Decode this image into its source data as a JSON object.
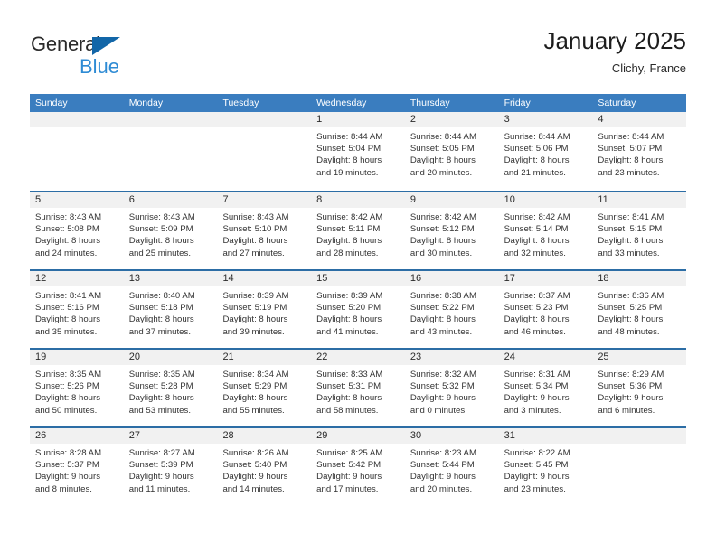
{
  "brand": {
    "name_top": "General",
    "name_bottom": "Blue",
    "triangle_color": "#1266a8",
    "blue_text_color": "#2e8bd4"
  },
  "header": {
    "title": "January 2025",
    "subtitle": "Clichy, France"
  },
  "theme": {
    "header_bar": "#3a7dbf",
    "row_divider": "#2c6da5",
    "day_number_band": "#f1f1f1",
    "cell_background": "#ffffff"
  },
  "weekdays": [
    "Sunday",
    "Monday",
    "Tuesday",
    "Wednesday",
    "Thursday",
    "Friday",
    "Saturday"
  ],
  "weeks": [
    [
      {
        "day": "",
        "lines": []
      },
      {
        "day": "",
        "lines": []
      },
      {
        "day": "",
        "lines": []
      },
      {
        "day": "1",
        "lines": [
          "Sunrise: 8:44 AM",
          "Sunset: 5:04 PM",
          "Daylight: 8 hours",
          "and 19 minutes."
        ]
      },
      {
        "day": "2",
        "lines": [
          "Sunrise: 8:44 AM",
          "Sunset: 5:05 PM",
          "Daylight: 8 hours",
          "and 20 minutes."
        ]
      },
      {
        "day": "3",
        "lines": [
          "Sunrise: 8:44 AM",
          "Sunset: 5:06 PM",
          "Daylight: 8 hours",
          "and 21 minutes."
        ]
      },
      {
        "day": "4",
        "lines": [
          "Sunrise: 8:44 AM",
          "Sunset: 5:07 PM",
          "Daylight: 8 hours",
          "and 23 minutes."
        ]
      }
    ],
    [
      {
        "day": "5",
        "lines": [
          "Sunrise: 8:43 AM",
          "Sunset: 5:08 PM",
          "Daylight: 8 hours",
          "and 24 minutes."
        ]
      },
      {
        "day": "6",
        "lines": [
          "Sunrise: 8:43 AM",
          "Sunset: 5:09 PM",
          "Daylight: 8 hours",
          "and 25 minutes."
        ]
      },
      {
        "day": "7",
        "lines": [
          "Sunrise: 8:43 AM",
          "Sunset: 5:10 PM",
          "Daylight: 8 hours",
          "and 27 minutes."
        ]
      },
      {
        "day": "8",
        "lines": [
          "Sunrise: 8:42 AM",
          "Sunset: 5:11 PM",
          "Daylight: 8 hours",
          "and 28 minutes."
        ]
      },
      {
        "day": "9",
        "lines": [
          "Sunrise: 8:42 AM",
          "Sunset: 5:12 PM",
          "Daylight: 8 hours",
          "and 30 minutes."
        ]
      },
      {
        "day": "10",
        "lines": [
          "Sunrise: 8:42 AM",
          "Sunset: 5:14 PM",
          "Daylight: 8 hours",
          "and 32 minutes."
        ]
      },
      {
        "day": "11",
        "lines": [
          "Sunrise: 8:41 AM",
          "Sunset: 5:15 PM",
          "Daylight: 8 hours",
          "and 33 minutes."
        ]
      }
    ],
    [
      {
        "day": "12",
        "lines": [
          "Sunrise: 8:41 AM",
          "Sunset: 5:16 PM",
          "Daylight: 8 hours",
          "and 35 minutes."
        ]
      },
      {
        "day": "13",
        "lines": [
          "Sunrise: 8:40 AM",
          "Sunset: 5:18 PM",
          "Daylight: 8 hours",
          "and 37 minutes."
        ]
      },
      {
        "day": "14",
        "lines": [
          "Sunrise: 8:39 AM",
          "Sunset: 5:19 PM",
          "Daylight: 8 hours",
          "and 39 minutes."
        ]
      },
      {
        "day": "15",
        "lines": [
          "Sunrise: 8:39 AM",
          "Sunset: 5:20 PM",
          "Daylight: 8 hours",
          "and 41 minutes."
        ]
      },
      {
        "day": "16",
        "lines": [
          "Sunrise: 8:38 AM",
          "Sunset: 5:22 PM",
          "Daylight: 8 hours",
          "and 43 minutes."
        ]
      },
      {
        "day": "17",
        "lines": [
          "Sunrise: 8:37 AM",
          "Sunset: 5:23 PM",
          "Daylight: 8 hours",
          "and 46 minutes."
        ]
      },
      {
        "day": "18",
        "lines": [
          "Sunrise: 8:36 AM",
          "Sunset: 5:25 PM",
          "Daylight: 8 hours",
          "and 48 minutes."
        ]
      }
    ],
    [
      {
        "day": "19",
        "lines": [
          "Sunrise: 8:35 AM",
          "Sunset: 5:26 PM",
          "Daylight: 8 hours",
          "and 50 minutes."
        ]
      },
      {
        "day": "20",
        "lines": [
          "Sunrise: 8:35 AM",
          "Sunset: 5:28 PM",
          "Daylight: 8 hours",
          "and 53 minutes."
        ]
      },
      {
        "day": "21",
        "lines": [
          "Sunrise: 8:34 AM",
          "Sunset: 5:29 PM",
          "Daylight: 8 hours",
          "and 55 minutes."
        ]
      },
      {
        "day": "22",
        "lines": [
          "Sunrise: 8:33 AM",
          "Sunset: 5:31 PM",
          "Daylight: 8 hours",
          "and 58 minutes."
        ]
      },
      {
        "day": "23",
        "lines": [
          "Sunrise: 8:32 AM",
          "Sunset: 5:32 PM",
          "Daylight: 9 hours",
          "and 0 minutes."
        ]
      },
      {
        "day": "24",
        "lines": [
          "Sunrise: 8:31 AM",
          "Sunset: 5:34 PM",
          "Daylight: 9 hours",
          "and 3 minutes."
        ]
      },
      {
        "day": "25",
        "lines": [
          "Sunrise: 8:29 AM",
          "Sunset: 5:36 PM",
          "Daylight: 9 hours",
          "and 6 minutes."
        ]
      }
    ],
    [
      {
        "day": "26",
        "lines": [
          "Sunrise: 8:28 AM",
          "Sunset: 5:37 PM",
          "Daylight: 9 hours",
          "and 8 minutes."
        ]
      },
      {
        "day": "27",
        "lines": [
          "Sunrise: 8:27 AM",
          "Sunset: 5:39 PM",
          "Daylight: 9 hours",
          "and 11 minutes."
        ]
      },
      {
        "day": "28",
        "lines": [
          "Sunrise: 8:26 AM",
          "Sunset: 5:40 PM",
          "Daylight: 9 hours",
          "and 14 minutes."
        ]
      },
      {
        "day": "29",
        "lines": [
          "Sunrise: 8:25 AM",
          "Sunset: 5:42 PM",
          "Daylight: 9 hours",
          "and 17 minutes."
        ]
      },
      {
        "day": "30",
        "lines": [
          "Sunrise: 8:23 AM",
          "Sunset: 5:44 PM",
          "Daylight: 9 hours",
          "and 20 minutes."
        ]
      },
      {
        "day": "31",
        "lines": [
          "Sunrise: 8:22 AM",
          "Sunset: 5:45 PM",
          "Daylight: 9 hours",
          "and 23 minutes."
        ]
      },
      {
        "day": "",
        "lines": []
      }
    ]
  ]
}
